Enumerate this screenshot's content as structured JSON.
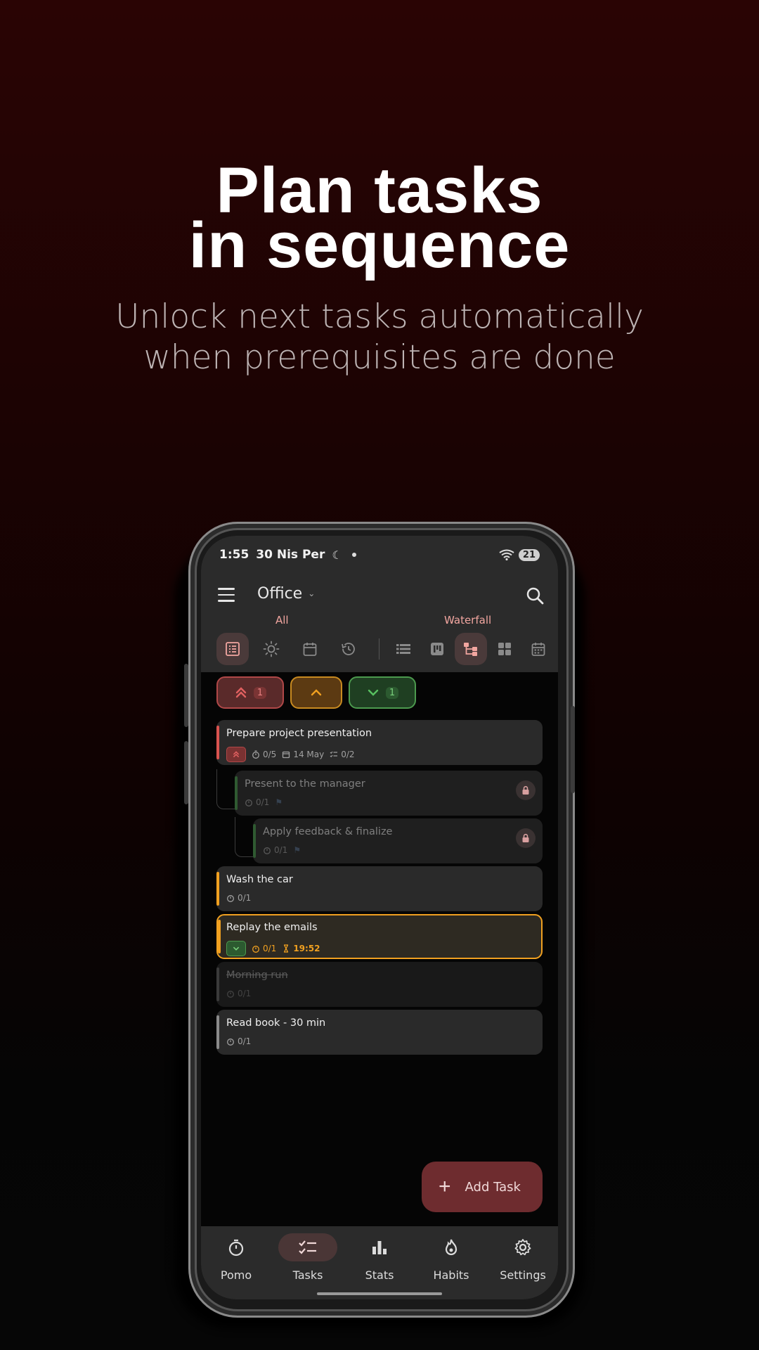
{
  "hero": {
    "title_line1": "Plan tasks",
    "title_line2": "in sequence",
    "subtitle_line1": "Unlock next tasks automatically",
    "subtitle_line2": "when prerequisites are done"
  },
  "status_bar": {
    "time": "1:55",
    "date": "30 Nis Per",
    "battery": "21"
  },
  "toolbar": {
    "project": "Office"
  },
  "view_tabs": {
    "left_label": "All",
    "right_label": "Waterfall"
  },
  "filter_chips": {
    "high_count": "1",
    "low_count": "1"
  },
  "tasks": [
    {
      "title": "Prepare project presentation",
      "pomo": "0/5",
      "date": "14 May",
      "subtasks": "0/2"
    },
    {
      "title": "Present to the manager",
      "pomo": "0/1"
    },
    {
      "title": "Apply feedback & finalize",
      "pomo": "0/1"
    },
    {
      "title": "Wash the car",
      "pomo": "0/1"
    },
    {
      "title": "Replay the emails",
      "pomo": "0/1",
      "timer": "19:52"
    },
    {
      "title": "Morning run",
      "pomo": "0/1"
    },
    {
      "title": "Read book - 30 min",
      "pomo": "0/1"
    }
  ],
  "fab": {
    "label": "Add Task"
  },
  "nav": [
    {
      "label": "Pomo"
    },
    {
      "label": "Tasks"
    },
    {
      "label": "Stats"
    },
    {
      "label": "Habits"
    },
    {
      "label": "Settings"
    }
  ],
  "colors": {
    "high": "#d9534f",
    "medium": "#f0a020",
    "low": "#4caf50",
    "accent": "#f2a6a0",
    "fab": "#6e2c2f"
  }
}
